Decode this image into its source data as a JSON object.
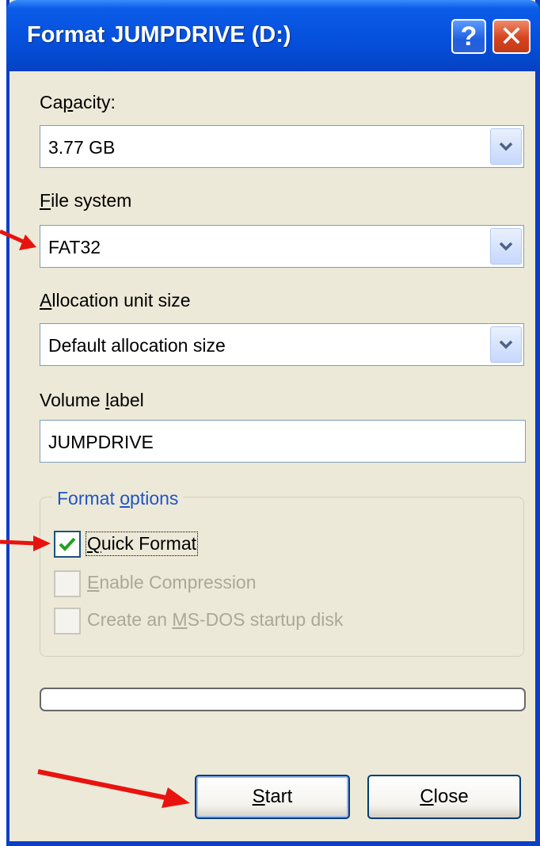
{
  "window": {
    "title": "Format JUMPDRIVE (D:)",
    "help_glyph": "?",
    "close_glyph": "✕"
  },
  "capacity": {
    "label_pre": "Ca",
    "label_key": "p",
    "label_post": "acity:",
    "value": "3.77 GB"
  },
  "file_system": {
    "label_key": "F",
    "label_post": "ile system",
    "value": "FAT32"
  },
  "allocation": {
    "label_key": "A",
    "label_post": "llocation unit size",
    "value": "Default allocation size"
  },
  "volume": {
    "label_pre": "Volume ",
    "label_key": "l",
    "label_post": "abel",
    "value": "JUMPDRIVE"
  },
  "format_options": {
    "legend_pre": "Format ",
    "legend_key": "o",
    "legend_post": "ptions",
    "quick": {
      "label_key": "Q",
      "label_post": "uick Format",
      "checked": true
    },
    "compression": {
      "label_key": "E",
      "label_post": "nable Compression",
      "checked": false,
      "disabled": true
    },
    "msdos": {
      "label_pre": "Create an ",
      "label_key": "M",
      "label_post": "S-DOS startup disk",
      "checked": false,
      "disabled": true
    }
  },
  "progress": {
    "percent": 0
  },
  "buttons": {
    "start": {
      "label_key": "S",
      "label_post": "tart"
    },
    "close": {
      "label_key": "C",
      "label_post": "lose"
    }
  },
  "colors": {
    "titlebar": "#0550dd",
    "dialog": "#ece9d8",
    "annotation_arrow": "#e8130f"
  },
  "icons": [
    "help-icon",
    "close-icon",
    "dropdown-arrow-icon",
    "checkmark-icon",
    "annotation-arrow-icon"
  ]
}
